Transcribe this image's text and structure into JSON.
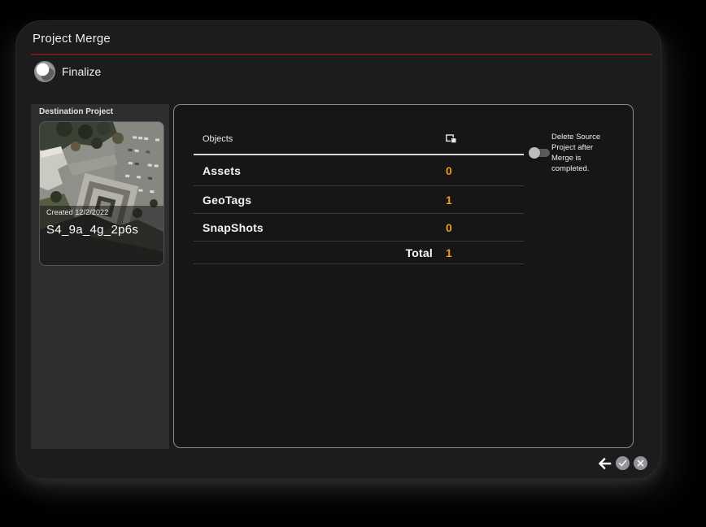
{
  "window": {
    "title": "Project Merge"
  },
  "finalize": {
    "label": "Finalize",
    "icon": "merge-circles-icon"
  },
  "destination": {
    "section_label": "Destination Project",
    "created": "Created 12/2/2022",
    "name": "S4_9a_4g_2p6s",
    "thumbnail": "aerial-photo-thumbnail"
  },
  "table": {
    "header": {
      "label": "Objects",
      "icon": "overlapping-frames-icon"
    },
    "rows": [
      {
        "label": "Assets",
        "value": "0"
      },
      {
        "label": "GeoTags",
        "value": "1"
      },
      {
        "label": "SnapShots",
        "value": "0"
      }
    ],
    "total": {
      "label": "Total",
      "value": "1"
    }
  },
  "delete_toggle": {
    "label": "Delete Source Project after Merge is completed.",
    "lines": [
      "Delete Source",
      "Project after",
      "Merge is",
      "completed."
    ],
    "state": "off"
  },
  "footer": {
    "back_icon": "back-arrow-icon",
    "confirm_icon": "check-circle-icon",
    "cancel_icon": "close-circle-icon"
  },
  "colors": {
    "accent_orange": "#ef9b1d",
    "rule_red": "#701b1e",
    "window_bg": "#1c1c1c",
    "left_panel_bg": "#2e2e2e",
    "panel_bg": "#161616",
    "divider": "#3a3a3a"
  }
}
